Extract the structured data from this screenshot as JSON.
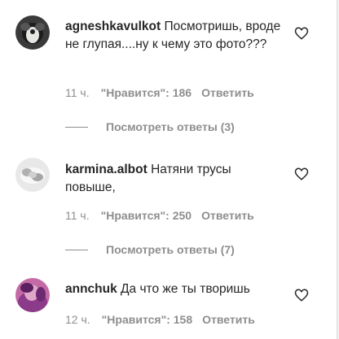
{
  "comments": [
    {
      "username": "agneshkavulkot",
      "text": "Посмотришь, вроде не глупая....ну к чему это фото???",
      "time": "11 ч.",
      "likes": "\"Нравится\": 186",
      "reply": "Ответить",
      "view_replies": "Посмотреть ответы (3)",
      "avatar_icon": "profile-photo-dark-fur"
    },
    {
      "username": "karmina.albot",
      "text": "Натяни трусы повыше,",
      "time": "11 ч.",
      "likes": "\"Нравится\": 250",
      "reply": "Ответить",
      "view_replies": "Посмотреть ответы (7)",
      "avatar_icon": "profile-photo-grey-fluffy"
    },
    {
      "username": "annchuk",
      "text": "Да что же ты творишь",
      "time": "12 ч.",
      "likes": "\"Нравится\": 158",
      "reply": "Ответить",
      "avatar_icon": "profile-photo-pink-purple"
    }
  ],
  "icons": {
    "like": "heart-outline-icon"
  },
  "colors": {
    "text": "#262626",
    "secondary": "#8e8e8e",
    "border": "#dbdbdb"
  }
}
